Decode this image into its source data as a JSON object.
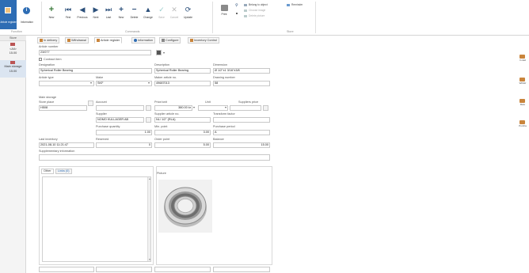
{
  "ribbon": {
    "article_register_label": "Article register",
    "information_label": "Information",
    "function_group": "Function",
    "commands_group": "Commands",
    "store_group": "Store",
    "new_label": "New",
    "first_label": "First",
    "previous_label": "Previous",
    "next_label": "Next",
    "last_label": "Last",
    "new2_label": "New",
    "delete_label": "Delete",
    "change_label": "Change",
    "save_label": "Save",
    "cancel_label": "Cancel",
    "update_label": "Update",
    "print_label": "Print",
    "belong_to_object": "Belong to object",
    "choose_image": "Choose image",
    "delete_picture": "Delete picture",
    "reminder": "Reminder"
  },
  "leftnav": {
    "header": "Store",
    "items": [
      {
        "title": "<All>",
        "count": "15.00"
      },
      {
        "title": "Main storage",
        "count": "15.00"
      }
    ]
  },
  "tabs": [
    {
      "label": "In delivery"
    },
    {
      "label": "Withdrawal"
    },
    {
      "label": "Article register"
    },
    {
      "label": "Information"
    },
    {
      "label": "Configure"
    },
    {
      "label": "Inventory Control"
    }
  ],
  "form": {
    "article_number_label": "Article number",
    "article_number": "23/077",
    "contract_item_label": "Contract item",
    "designation_label": "Designation",
    "designation": "Spherical Roller Bearing",
    "description_label": "Description",
    "description": "Spherical Roller Bearing",
    "dimension_label": "Dimension",
    "dimension": "Ø 1/2\"x1 3/16\"x3/8",
    "article_type_label": "Article type",
    "article_type": "",
    "make_label": "Make",
    "make": "SKF",
    "maker_article_no_label": "Maker article no.",
    "maker_article_no": "49687013",
    "drawing_number_label": "Drawing number",
    "drawing_number": "58",
    "main_storage_label": "Main storage",
    "store_place_label": "Store place",
    "store_place": "H508",
    "account_label": "Account",
    "account": "",
    "price_unit_label": "Price/unit",
    "price_unit": "380.00 kr",
    "unit_label": "Unit",
    "suppliers_price_label": "Suppliers price",
    "supplier_label": "Supplier",
    "supplier": "NOMO KULLAGER AB",
    "supplier_article_no_label": "Supplier article no.",
    "supplier_article_no": "NL/ 1/2\" (RLA)",
    "transform_factor_label": "Transform factor",
    "purchase_quantity_label": "Purchase quantity",
    "purchase_quantity": "1.00",
    "min_point_label": "Min. point",
    "min_point": "3.00",
    "purchase_period_label": "Purchase period",
    "purchase_period": "A",
    "last_inventory_label": "Last inventory",
    "last_inventory": "2021-08-10 11:21:47",
    "reserved_label": "Reserved",
    "reserved": "0",
    "order_point_label": "Order point",
    "order_point": "5.00",
    "balance_label": "Balance",
    "balance": "15.00",
    "supplementary_label": "Supplementary information"
  },
  "lower_tabs": [
    {
      "label": "Other"
    },
    {
      "label": "Links (0)"
    }
  ],
  "picture_label": "Picture",
  "right_actions": [
    {
      "label": "In deli"
    },
    {
      "label": "Withdr"
    },
    {
      "label": "Retu"
    },
    {
      "label": "Purcha"
    }
  ],
  "colors": {
    "accent": "#2e6db4",
    "orange": "#c9853c"
  }
}
